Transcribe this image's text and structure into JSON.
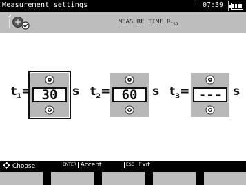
{
  "titlebar": {
    "title": "Measurement settings",
    "time": "07:39"
  },
  "header": {
    "mode_icon": "insulation-resistance-icon",
    "measure_title": "MEASURE TIME R",
    "measure_title_sub": "ISO"
  },
  "times": [
    {
      "label": "t",
      "sub": "1",
      "eq": "=",
      "value": "30",
      "unit": "s",
      "selected": true
    },
    {
      "label": "t",
      "sub": "2",
      "eq": "=",
      "value": "60",
      "unit": "s",
      "selected": false
    },
    {
      "label": "t",
      "sub": "3",
      "eq": "=",
      "value": "---",
      "unit": "s",
      "selected": false
    }
  ],
  "footer": {
    "choose_label": "Choose",
    "enter_key": "ENTER",
    "accept_label": "Accept",
    "esc_key": "ESC",
    "exit_label": "Exit"
  },
  "colors": {
    "header": "#bdbdbd",
    "spinner": "#b8b8b8",
    "background": "#000000",
    "panel": "#ffffff"
  }
}
